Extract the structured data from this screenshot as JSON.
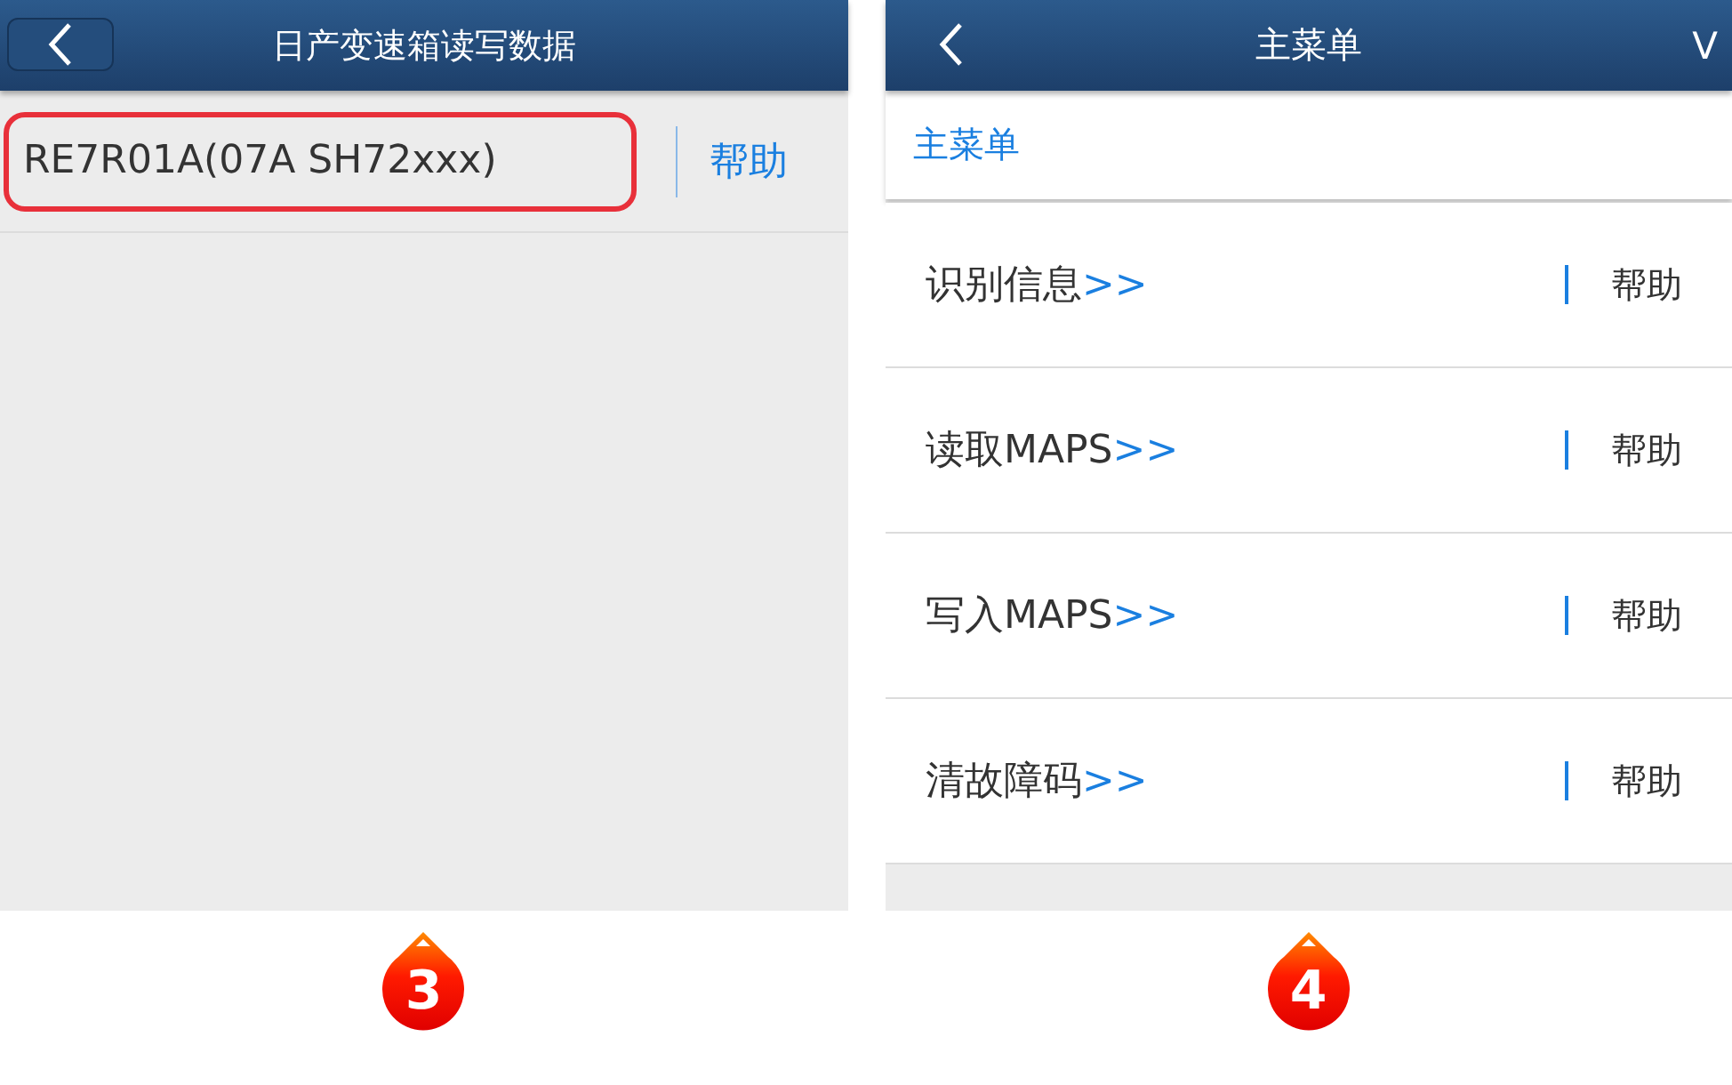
{
  "screens": [
    {
      "kind": "list",
      "title": "日产变速箱读写数据",
      "step": "3",
      "items": [
        {
          "label": "RE7R01A(07A SH72xxx)",
          "help": "帮助",
          "highlighted": true
        }
      ]
    },
    {
      "kind": "menu",
      "title": "主菜单",
      "corner": "V",
      "breadcrumb": "主菜单",
      "step": "4",
      "items": [
        {
          "label": "识别信息",
          "arrow": ">>",
          "help": "帮助",
          "highlighted": false
        },
        {
          "label": "读取MAPS",
          "arrow": ">>",
          "help": "帮助",
          "highlighted": false
        },
        {
          "label": "写入MAPS",
          "arrow": ">>",
          "help": "帮助",
          "highlighted": false
        },
        {
          "label": "清故障码",
          "arrow": ">>",
          "help": "帮助",
          "highlighted": false
        }
      ]
    }
  ]
}
